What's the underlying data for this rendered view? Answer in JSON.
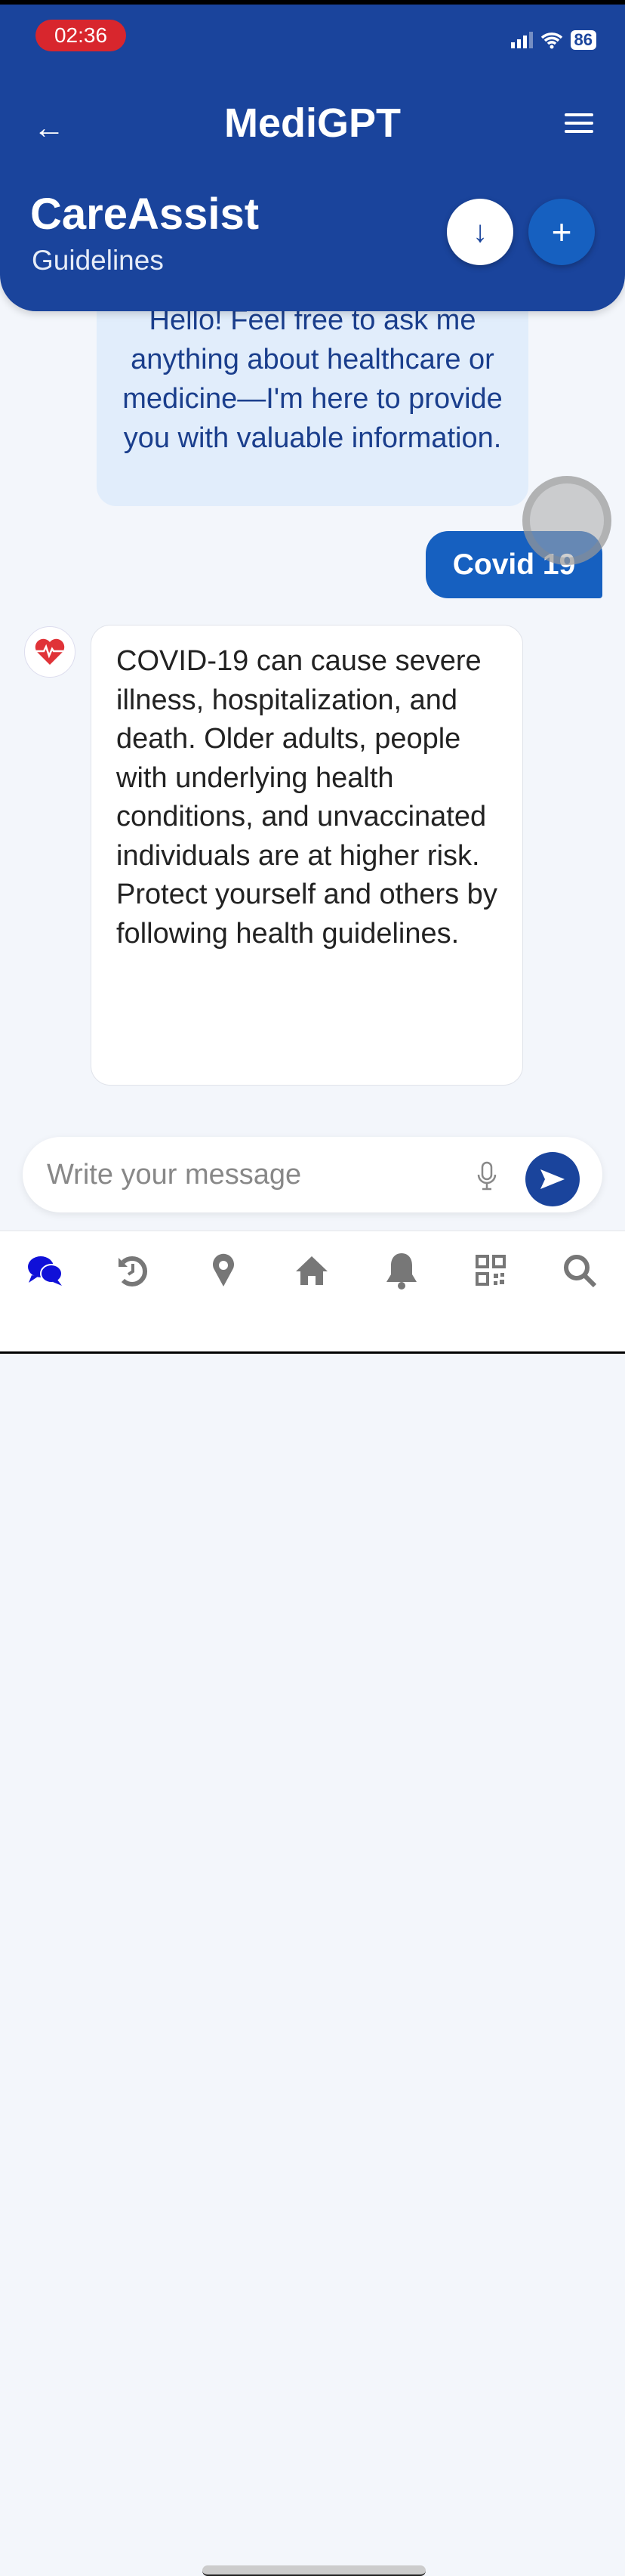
{
  "status_bar": {
    "time": "02:36",
    "battery": "86"
  },
  "header": {
    "app_title": "MediGPT",
    "section_title": "CareAssist",
    "section_subtitle": "Guidelines"
  },
  "messages": [
    {
      "role": "bot",
      "text": "Hello! Feel free to ask me anything about healthcare or medicine—I'm here to provide you with valuable information."
    },
    {
      "role": "user",
      "text": "Covid 19"
    },
    {
      "role": "bot",
      "text": "COVID-19 can cause severe illness, hospitalization, and death. Older adults, people with underlying health conditions, and unvaccinated individuals are at higher risk. Protect yourself and others by following health guidelines."
    }
  ],
  "composer": {
    "placeholder": "Write your message",
    "value": ""
  },
  "nav": [
    "chat-icon",
    "history-icon",
    "location-icon",
    "home-icon",
    "bell-icon",
    "qr-code-icon",
    "search-icon"
  ],
  "colors": {
    "primary": "#1a449c",
    "accent": "#1660c0",
    "active_nav": "#1010d8",
    "inactive_nav": "#777777"
  }
}
